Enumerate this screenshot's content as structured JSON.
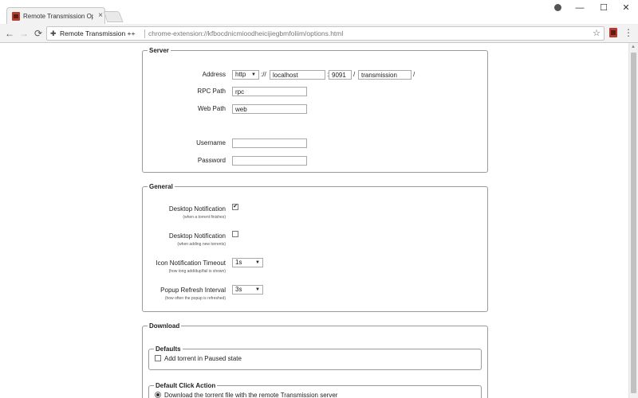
{
  "browser": {
    "tab_title": "Remote Transmission Op",
    "tab_close": "×",
    "site_name": "Remote Transmission ++",
    "url": "chrome-extension://kfbocdnicmioodheicijiegbmfoliim/options.html",
    "icons": {
      "profile": "profile-icon",
      "minimize": "minimize-icon",
      "maximize": "maximize-icon",
      "close": "close-icon",
      "back": "back-arrow-icon",
      "forward": "forward-arrow-icon",
      "reload": "reload-icon",
      "extension": "puzzle-icon",
      "bookmark": "star-icon",
      "menu": "kebab-menu-icon"
    },
    "glyphs": {
      "minimize": "—",
      "maximize": "☐",
      "close": "✕",
      "back": "←",
      "forward": "→",
      "reload": "⟳",
      "puzzle": "✚",
      "star": "☆",
      "menu": "⋮"
    }
  },
  "server": {
    "legend": "Server",
    "address_label": "Address",
    "protocol": "http",
    "sep_scheme": "://",
    "host": "localhost",
    "sep_port": ":",
    "port": "9091",
    "sep_path": "/",
    "path": "transmission",
    "sep_end": "/",
    "rpc_label": "RPC Path",
    "rpc_value": "rpc",
    "web_label": "Web Path",
    "web_value": "web",
    "username_label": "Username",
    "username_value": "",
    "password_label": "Password",
    "password_value": ""
  },
  "general": {
    "legend": "General",
    "notif1_label": "Desktop Notification",
    "notif1_hint": "(when a torrent finishes)",
    "notif1_checked": true,
    "notif2_label": "Desktop Notification",
    "notif2_hint": "(when adding new torrents)",
    "notif2_checked": false,
    "timeout_label": "Icon Notification Timeout",
    "timeout_hint": "(how long add/dup/fail is shown)",
    "timeout_value": "1s",
    "refresh_label": "Popup Refresh Interval",
    "refresh_hint": "(how often the popup is refreshed)",
    "refresh_value": "3s",
    "check_mark": "✔"
  },
  "download": {
    "legend": "Download",
    "defaults_legend": "Defaults",
    "paused_label": "Add torrent in Paused state",
    "paused_checked": false,
    "click_legend": "Default Click Action",
    "click_option": "Download the torrent file with the remote Transmission server"
  },
  "colors": {
    "favicon": "#b63b2c",
    "toolbar": "#f2f2f2",
    "border": "#9a9a9a"
  }
}
